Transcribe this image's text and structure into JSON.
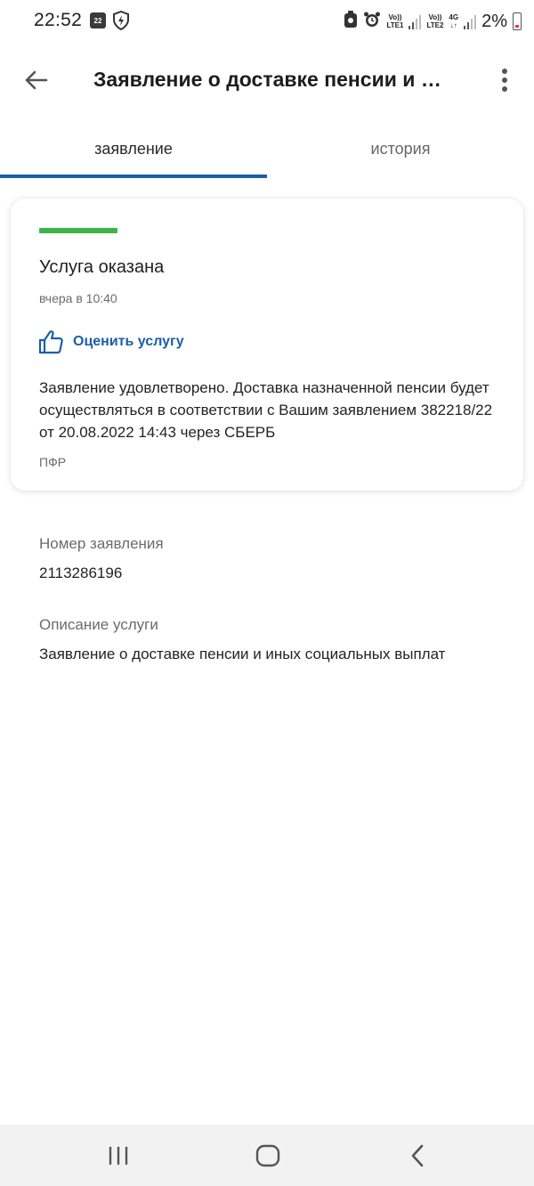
{
  "status_bar": {
    "time": "22:52",
    "calendar_day": "22",
    "volte1_top": "Vo))",
    "volte1_bottom": "LTE1",
    "volte2_top": "Vo))",
    "volte2_bottom": "LTE2",
    "network": "4G",
    "battery_percent": "2%"
  },
  "app_bar": {
    "title": "Заявление о доставке пенсии и иных социальных выплат",
    "back_icon": "arrow-left-icon",
    "more_icon": "more-vertical-icon"
  },
  "tabs": [
    {
      "label": "заявление",
      "active": true
    },
    {
      "label": "история",
      "active": false
    }
  ],
  "status_card": {
    "status_title": "Услуга оказана",
    "status_time": "вчера в 10:40",
    "status_color": "#3bb54a",
    "rate_label": "Оценить услугу",
    "rate_icon": "thumbs-up-icon",
    "message": "Заявление удовлетворено. Доставка назначенной пенсии будет осуществляться в соответствии с Вашим заявлением 382218/22 от 20.08.2022 14:43 через СБЕРБ",
    "organization": "ПФР"
  },
  "details": {
    "number_label": "Номер заявления",
    "number_value": "2113286196",
    "description_label": "Описание услуги",
    "description_value": "Заявление о доставке пенсии и иных социальных выплат"
  },
  "colors": {
    "accent": "#1b5fa8",
    "success": "#3bb54a"
  }
}
